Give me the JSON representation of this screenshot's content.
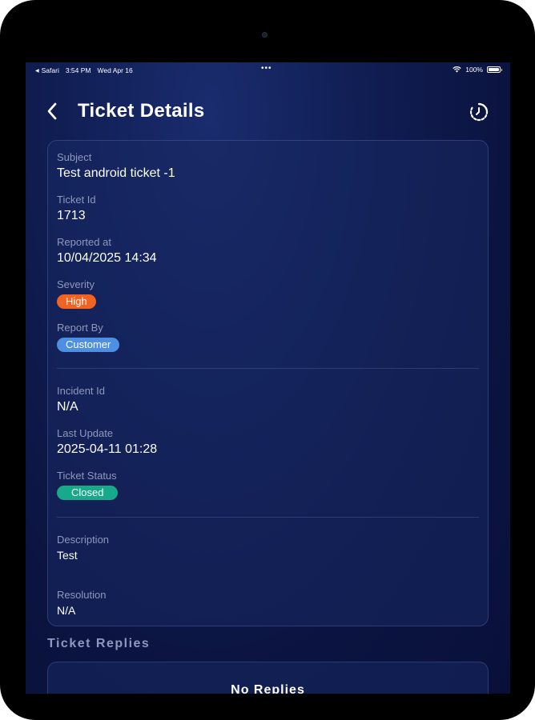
{
  "status_bar": {
    "back_app": "Safari",
    "time": "3:54 PM",
    "date": "Wed Apr 16",
    "dots": "•••",
    "battery_percent": "100%"
  },
  "header": {
    "title": "Ticket Details",
    "back_icon": "chevron-left-icon",
    "history_icon": "history-icon"
  },
  "ticket": {
    "subject": {
      "label": "Subject",
      "value": "Test android ticket -1"
    },
    "ticket_id": {
      "label": "Ticket Id",
      "value": "1713"
    },
    "reported_at": {
      "label": "Reported at",
      "value": "10/04/2025 14:34"
    },
    "severity": {
      "label": "Severity",
      "value": "High",
      "color": "#f26322"
    },
    "report_by": {
      "label": "Report By",
      "value": "Customer",
      "color": "#4d8fe0"
    },
    "incident_id": {
      "label": "Incident Id",
      "value": "N/A"
    },
    "last_update": {
      "label": "Last Update",
      "value": "2025-04-11 01:28"
    },
    "ticket_status": {
      "label": "Ticket Status",
      "value": "Closed",
      "color": "#16a98a"
    },
    "description": {
      "label": "Description",
      "value": "Test"
    },
    "resolution": {
      "label": "Resolution",
      "value": "N/A"
    }
  },
  "replies": {
    "section_title": "Ticket Replies",
    "empty_text": "No Replies"
  },
  "colors": {
    "background": "#0b1440",
    "card": "#18286a",
    "label": "#8e98bd",
    "text": "#ffffff"
  }
}
